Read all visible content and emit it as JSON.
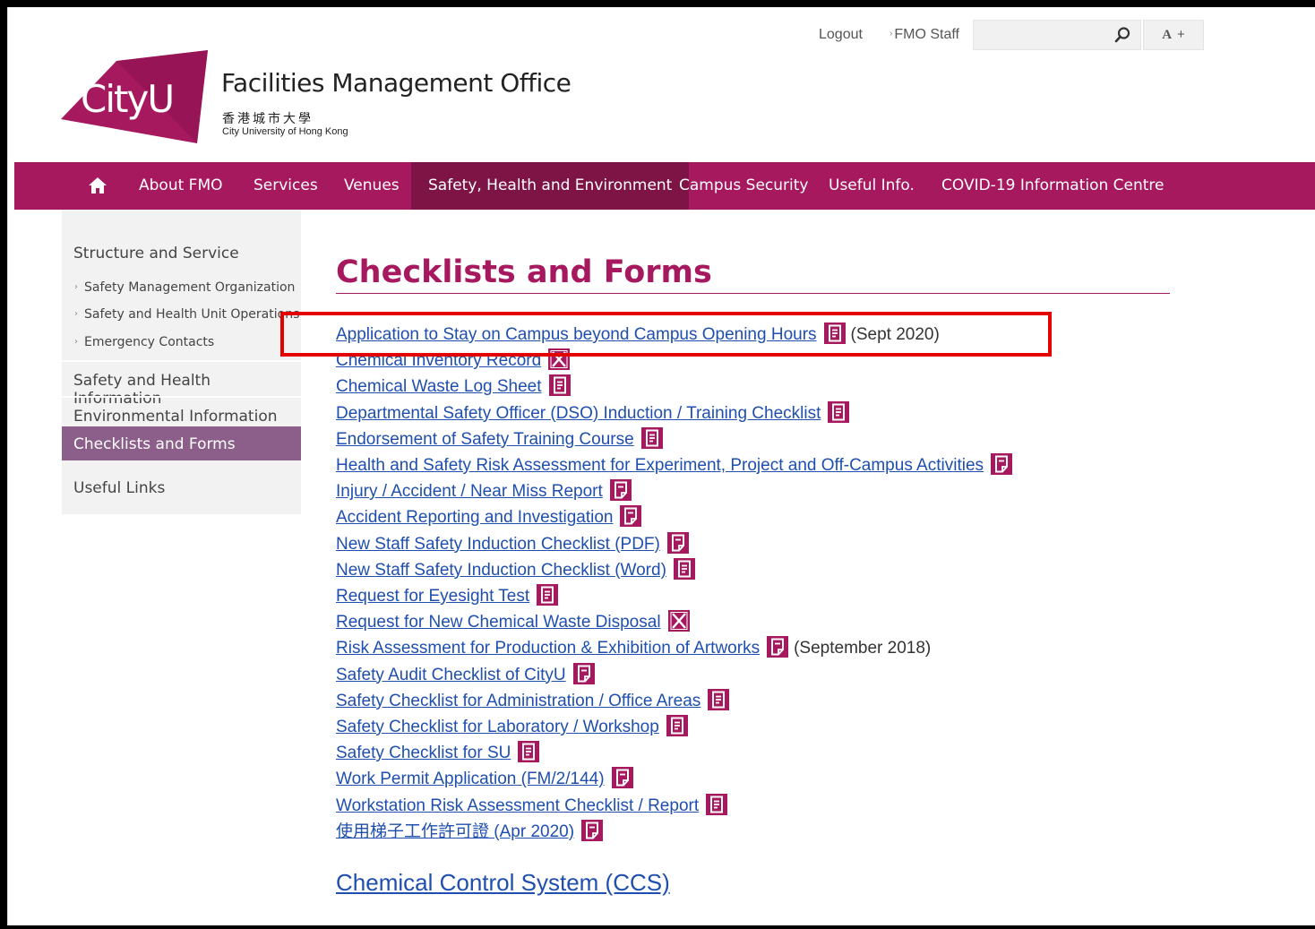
{
  "utility": {
    "logout": "Logout",
    "staff": "FMO Staff",
    "search_placeholder": "",
    "font_size_label": "A",
    "font_size_plus": "+"
  },
  "header": {
    "logo_text": "CityU",
    "org_name": "Facilities Management Office",
    "univ_cn": "香港城市大學",
    "univ_en": "City University of Hong Kong"
  },
  "nav": {
    "items": [
      "About FMO",
      "Services",
      "Venues",
      "Safety, Health and Environment",
      "Campus Security",
      "Useful Info.",
      "COVID-19 Information Centre"
    ],
    "active_index": 3
  },
  "sidebar": {
    "structure": "Structure and Service",
    "sub_items": [
      "Safety Management Organization",
      "Safety and Health Unit Operations",
      "Emergency Contacts"
    ],
    "health_info": "Safety and Health Information",
    "env_info": "Environmental Information",
    "checklists": "Checklists and Forms",
    "useful_links": "Useful Links"
  },
  "content": {
    "title": "Checklists and Forms",
    "forms": [
      {
        "label": "Application to Stay on Campus beyond Campus Opening Hours",
        "icon": "word",
        "note": "(Sept 2020)"
      },
      {
        "label": "Chemical Inventory Record",
        "icon": "excel",
        "note": ""
      },
      {
        "label": "Chemical Waste Log Sheet",
        "icon": "word",
        "note": ""
      },
      {
        "label": "Departmental Safety Officer (DSO) Induction / Training Checklist",
        "icon": "word",
        "note": ""
      },
      {
        "label": "Endorsement of Safety Training Course",
        "icon": "word",
        "note": ""
      },
      {
        "label": "Health and Safety Risk Assessment for Experiment, Project and Off-Campus Activities",
        "icon": "pdf",
        "note": ""
      },
      {
        "label": "Injury / Accident / Near Miss Report",
        "icon": "pdf",
        "note": ""
      },
      {
        "label": "Accident Reporting and Investigation",
        "icon": "pdf",
        "note": ""
      },
      {
        "label": "New Staff Safety Induction Checklist (PDF)",
        "icon": "pdf",
        "note": ""
      },
      {
        "label": "New Staff Safety Induction Checklist (Word)",
        "icon": "word",
        "note": ""
      },
      {
        "label": "Request for Eyesight Test",
        "icon": "word",
        "note": ""
      },
      {
        "label": "Request for New Chemical Waste Disposal",
        "icon": "excel",
        "note": ""
      },
      {
        "label": "Risk Assessment for Production & Exhibition of Artworks",
        "icon": "pdf",
        "note": "(September 2018)"
      },
      {
        "label": "Safety Audit Checklist of CityU",
        "icon": "pdf",
        "note": ""
      },
      {
        "label": "Safety Checklist for Administration / Office Areas",
        "icon": "word",
        "note": ""
      },
      {
        "label": "Safety Checklist for Laboratory / Workshop",
        "icon": "word",
        "note": ""
      },
      {
        "label": "Safety Checklist for SU",
        "icon": "word",
        "note": ""
      },
      {
        "label": "Work Permit Application (FM/2/144)",
        "icon": "pdf",
        "note": ""
      },
      {
        "label": "Workstation Risk Assessment Checklist / Report",
        "icon": "word",
        "note": ""
      },
      {
        "label": "使用梯子工作許可證 (Apr 2020)",
        "icon": "pdf",
        "note": ""
      }
    ],
    "ccs_link": "Chemical Control System (CCS)",
    "highlight_color": "#e30000",
    "brand_color": "#a6195f",
    "link_color": "#1f4fae"
  }
}
